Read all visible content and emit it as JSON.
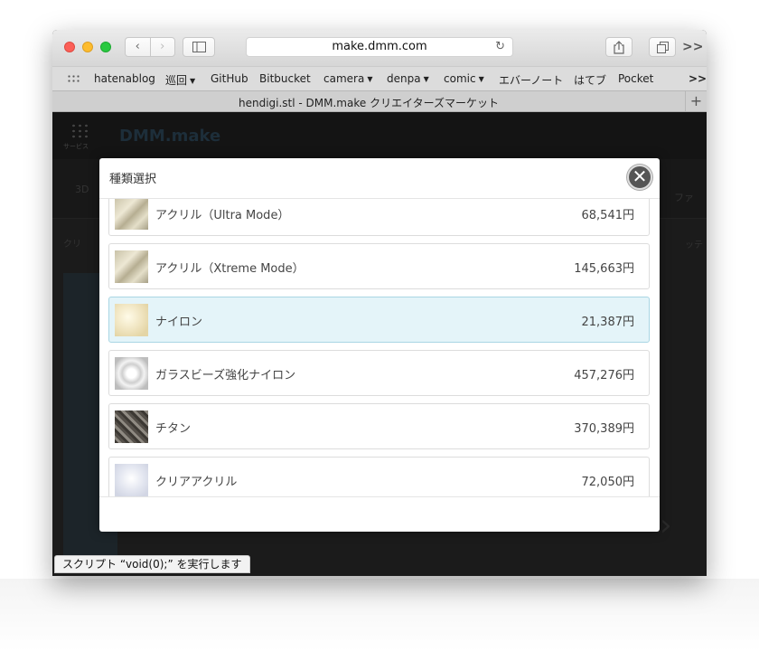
{
  "toolbar": {
    "back_label": "‹",
    "forward_label": "›",
    "address": "make.dmm.com",
    "overflow_label": ">>"
  },
  "bookmarks": [
    {
      "label": "hatenablog",
      "has_menu": false
    },
    {
      "label": "巡回",
      "has_menu": true
    },
    {
      "label": "GitHub",
      "has_menu": false
    },
    {
      "label": "Bitbucket",
      "has_menu": false
    },
    {
      "label": "camera",
      "has_menu": true
    },
    {
      "label": "denpa",
      "has_menu": true
    },
    {
      "label": "comic",
      "has_menu": true
    },
    {
      "label": "エバーノート",
      "has_menu": false
    },
    {
      "label": "はてブ",
      "has_menu": false
    },
    {
      "label": "Pocket",
      "has_menu": false
    }
  ],
  "bookmarks_overflow": ">>",
  "tab": {
    "title": "hendigi.stl - DMM.make クリエイターズマーケット",
    "new_tab_label": "+"
  },
  "page": {
    "service_label": "サービス",
    "logo": "DMM.make",
    "nav_left": "3D",
    "nav_right": "ファ",
    "crumb_left": "クリ",
    "crumb_right": "ッテ"
  },
  "modal": {
    "title": "種類選択",
    "close_label": "✕",
    "items": [
      {
        "name": "アクリル（Ultra Mode）",
        "price": "68,541円",
        "selected": false,
        "thumb": "acrylic-thumbnail"
      },
      {
        "name": "アクリル（Xtreme Mode）",
        "price": "145,663円",
        "selected": false,
        "thumb": "acrylic-thumbnail"
      },
      {
        "name": "ナイロン",
        "price": "21,387円",
        "selected": true,
        "thumb": "nylon-thumbnail"
      },
      {
        "name": "ガラスビーズ強化ナイロン",
        "price": "457,276円",
        "selected": false,
        "thumb": "glass-bead-nylon-thumbnail"
      },
      {
        "name": "チタン",
        "price": "370,389円",
        "selected": false,
        "thumb": "titanium-thumbnail"
      },
      {
        "name": "クリアアクリル",
        "price": "72,050円",
        "selected": false,
        "thumb": "clear-acrylic-thumbnail"
      }
    ]
  },
  "status_bar": {
    "text": "スクリプト “void(0);” を実行します"
  },
  "colors": {
    "selected_row_bg": "#e4f4f9",
    "selected_row_border": "#a9d6e4",
    "close_button": "#555555"
  }
}
